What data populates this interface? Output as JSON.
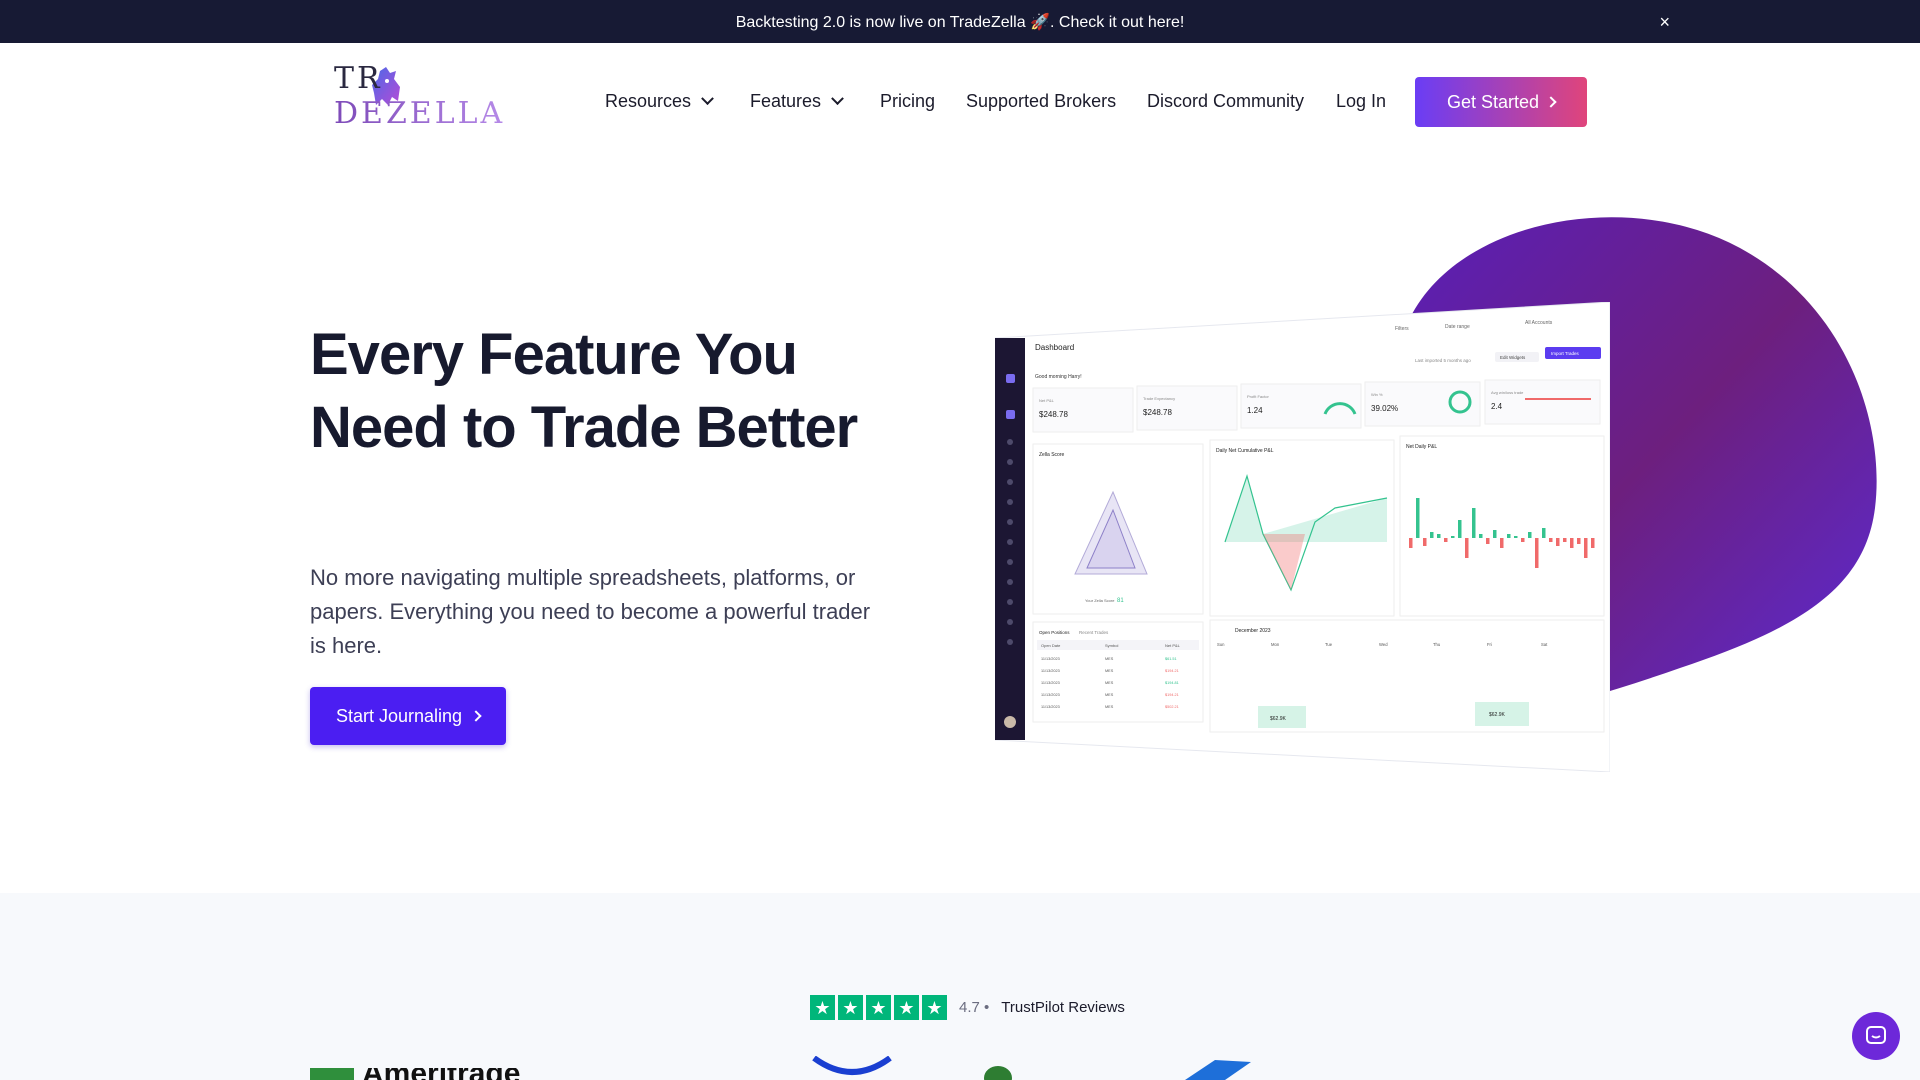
{
  "announcement": {
    "text": "Backtesting 2.0 is now live on TradeZella 🚀. Check it out here!",
    "close": "×"
  },
  "logo": {
    "part1": "TR",
    "part2": "DEZELLA"
  },
  "nav": {
    "resources": "Resources",
    "features": "Features",
    "pricing": "Pricing",
    "brokers": "Supported Brokers",
    "discord": "Discord Community",
    "login": "Log In",
    "get_started": "Get Started"
  },
  "hero": {
    "title": "Every Feature You Need to Trade Better",
    "subtitle": "No more navigating multiple spreadsheets, platforms, or papers. Everything you need to become a powerful trader is here.",
    "cta": "Start Journaling"
  },
  "dashboard": {
    "title": "Dashboard",
    "greeting": "Good morning Harry!",
    "filters": "Filters",
    "date_range": "Date range",
    "all_accounts": "All Accounts",
    "last_imported": "Last imported 5 months ago",
    "edit_widgets": "Edit Widgets",
    "import_trades": "Import Trades",
    "stats": [
      {
        "label": "Net P&L",
        "value": "$248.78"
      },
      {
        "label": "Trade Expectancy",
        "value": "$248.78"
      },
      {
        "label": "Profit Factor",
        "value": "1.24"
      },
      {
        "label": "Win %",
        "value": "39.02%"
      },
      {
        "label": "Avg win/loss trade",
        "value": "2.4"
      }
    ],
    "panels": {
      "zella": "Zella Score",
      "cumulative": "Daily Net Cumulative P&L",
      "daily": "Net Daily P&L"
    },
    "zella_score_label": "Your Zella Score",
    "zella_score": "81",
    "tabs": [
      "Open Positions",
      "Recent Trades"
    ],
    "table_headers": [
      "Open Date",
      "Symbol",
      "Net P&L"
    ],
    "rows": [
      [
        "11/13/2023",
        "MES",
        "$61.51"
      ],
      [
        "11/13/2023",
        "MES",
        "$194.21"
      ],
      [
        "11/13/2023",
        "MES",
        "$194.81"
      ],
      [
        "11/13/2023",
        "MES",
        "$194.21"
      ],
      [
        "11/13/2023",
        "MES",
        "$502.21"
      ]
    ],
    "calendar_month": "December 2023",
    "weekdays": [
      "Sun",
      "Mon",
      "Tue",
      "Wed",
      "Thu",
      "Fri",
      "Sat"
    ],
    "cal_value": "$62.9K"
  },
  "trustpilot": {
    "score": "4.7",
    "sep": "•",
    "label": "TrustPilot Reviews"
  },
  "brands": {
    "td": "Ameritrade"
  },
  "colors": {
    "accent": "#4b1ef2",
    "announce_bg": "#171a34",
    "trustpilot": "#00b67a"
  },
  "icons": {
    "chat": "chat-bubble-icon",
    "close": "close-icon",
    "star": "star-icon"
  }
}
